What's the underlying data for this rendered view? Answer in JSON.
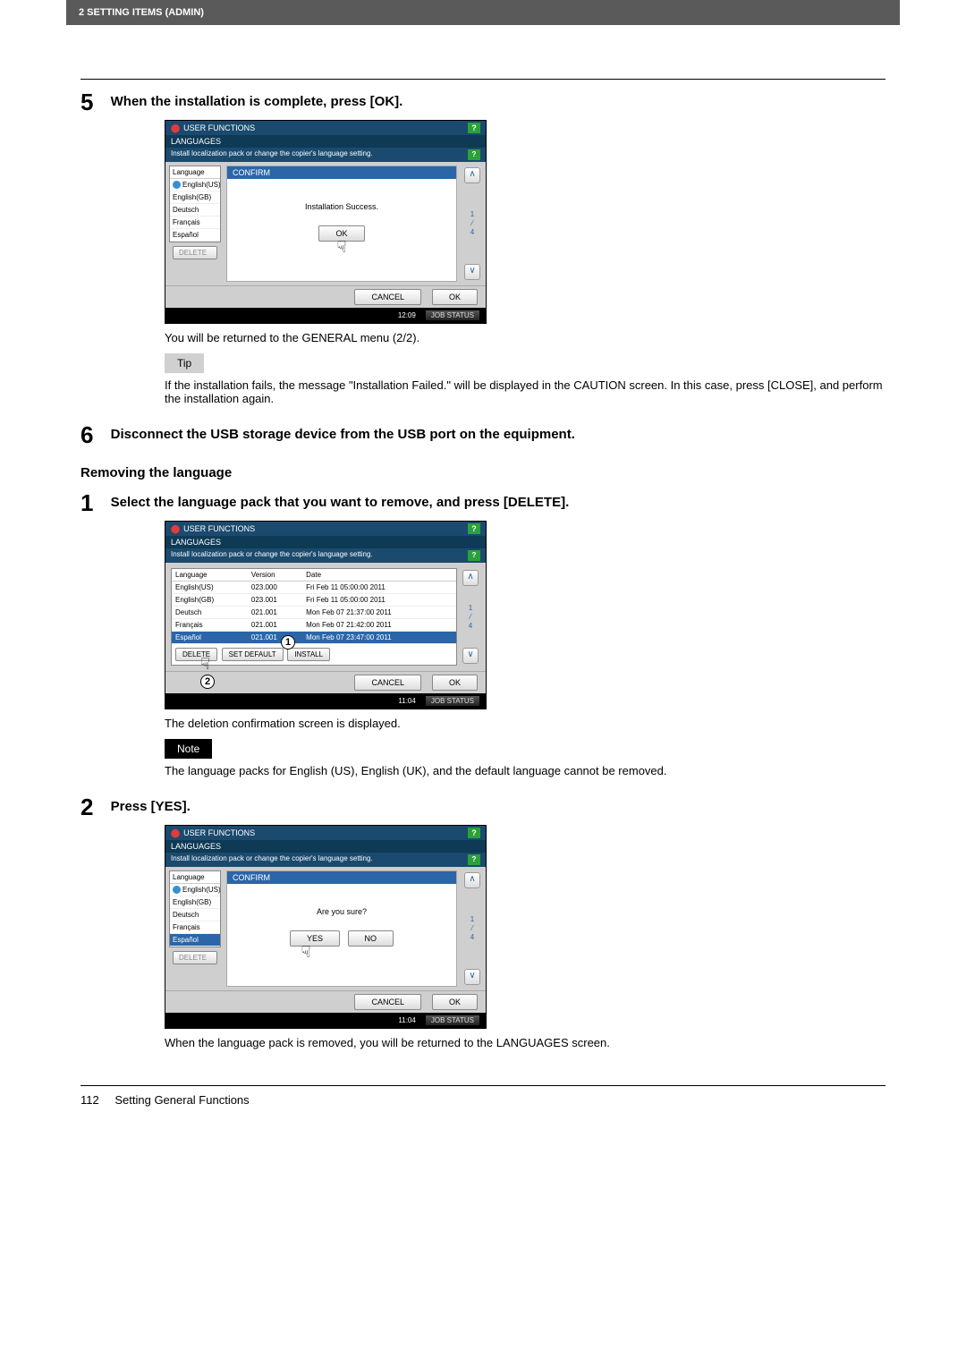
{
  "header": "2 SETTING ITEMS (ADMIN)",
  "step5": {
    "num": "5",
    "head": "When the installation is complete, press [OK].",
    "body": "You will be returned to the GENERAL menu (2/2).",
    "tip_label": "Tip",
    "tip_text": "If the installation fails, the message \"Installation Failed.\" will be displayed in the CAUTION screen. In this case, press [CLOSE], and perform the installation again."
  },
  "ss1": {
    "title": "USER FUNCTIONS",
    "sub": "LANGUAGES",
    "bar": "Install localization pack or change the copier's language setting.",
    "left_hdr": "Language",
    "rows": [
      "English(US)",
      "English(GB)",
      "Deutsch",
      "Français",
      "Español"
    ],
    "delete": "DELETE",
    "confirm_title": "CONFIRM",
    "confirm_msg": "Installation Success.",
    "ok": "OK",
    "page_top": "1",
    "page_bot": "4",
    "cancel": "CANCEL",
    "ok2": "OK",
    "time": "12:09",
    "job": "JOB STATUS"
  },
  "step6": {
    "num": "6",
    "head": "Disconnect the USB storage device from the USB port on the equipment."
  },
  "removing_head": "Removing the language",
  "r1": {
    "num": "1",
    "head": "Select the language pack that you want to remove, and press [DELETE].",
    "body": "The deletion confirmation screen is displayed.",
    "note_label": "Note",
    "note_text": "The language packs for English (US), English (UK), and the default language cannot be removed."
  },
  "ss2": {
    "title": "USER FUNCTIONS",
    "sub": "LANGUAGES",
    "bar": "Install localization pack or change the copier's language setting.",
    "cols": [
      "Language",
      "Version",
      "Date"
    ],
    "rows": [
      {
        "lang": "English(US)",
        "ver": "023.000",
        "date": "Fri Feb 11 05:00:00 2011",
        "chk": true
      },
      {
        "lang": "English(GB)",
        "ver": "023.001",
        "date": "Fri Feb 11 05:00:00 2011"
      },
      {
        "lang": "Deutsch",
        "ver": "021.001",
        "date": "Mon Feb 07 21:37:00 2011"
      },
      {
        "lang": "Français",
        "ver": "021.001",
        "date": "Mon Feb 07 21:42:00 2011"
      },
      {
        "lang": "Español",
        "ver": "021.001",
        "date": "Mon Feb 07 23:47:00 2011",
        "sel": true
      }
    ],
    "btns": [
      "DELETE",
      "SET DEFAULT",
      "INSTALL"
    ],
    "page_top": "1",
    "page_bot": "4",
    "cancel": "CANCEL",
    "ok": "OK",
    "time": "11:04",
    "job": "JOB STATUS"
  },
  "r2": {
    "num": "2",
    "head": "Press [YES].",
    "body": "When the language pack is removed, you will be returned to the LANGUAGES screen."
  },
  "ss3": {
    "title": "USER FUNCTIONS",
    "sub": "LANGUAGES",
    "bar": "Install localization pack or change the copier's language setting.",
    "left_hdr": "Language",
    "rows": [
      "English(US)",
      "English(GB)",
      "Deutsch",
      "Français",
      "Español"
    ],
    "delete": "DELETE",
    "confirm_title": "CONFIRM",
    "confirm_msg": "Are you sure?",
    "yes": "YES",
    "no": "NO",
    "page_top": "1",
    "page_bot": "4",
    "cancel": "CANCEL",
    "ok": "OK",
    "time": "11:04",
    "job": "JOB STATUS"
  },
  "footer": {
    "page": "112",
    "title": "Setting General Functions"
  }
}
